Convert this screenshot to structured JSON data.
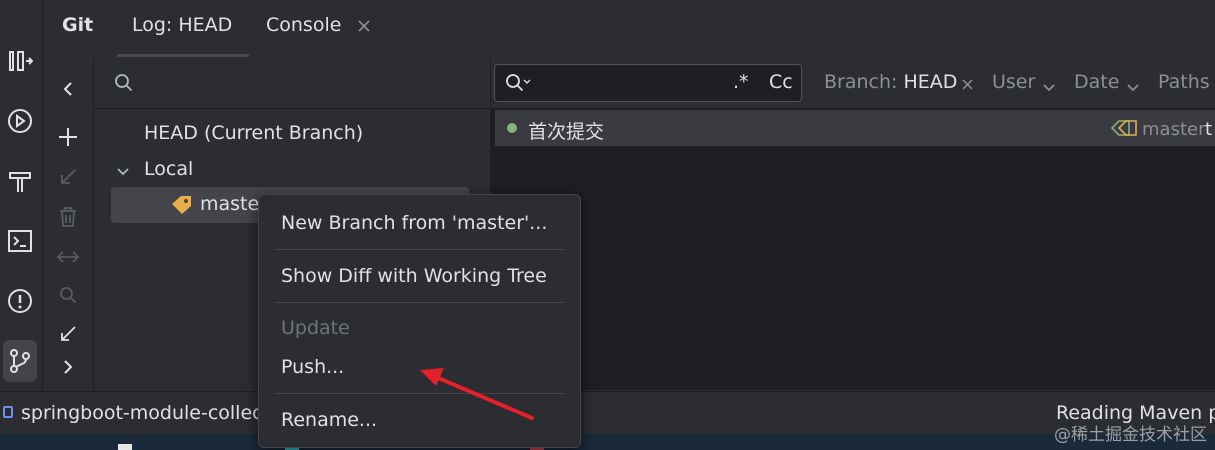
{
  "tabs": {
    "git": "Git",
    "log": "Log: HEAD",
    "console": "Console"
  },
  "branches": {
    "head_label": "HEAD (Current Branch)",
    "local_label": "Local",
    "selected_branch": "master"
  },
  "log": {
    "search_regex": ".*",
    "search_case": "Cc",
    "filters": {
      "branch_key": "Branch: ",
      "branch_value": "HEAD",
      "user": "User",
      "date": "Date",
      "paths": "Paths"
    },
    "commit": {
      "message": "首次提交",
      "ref": "master",
      "trailing": "t"
    }
  },
  "context_menu": {
    "items": [
      {
        "label": "New Branch from 'master'...",
        "enabled": true
      },
      {
        "label": "Show Diff with Working Tree",
        "enabled": true
      },
      {
        "label": "Update",
        "enabled": false
      },
      {
        "label": "Push...",
        "enabled": true
      },
      {
        "label": "Rename...",
        "enabled": true
      }
    ]
  },
  "statusbar": {
    "project": "springboot-module-collec",
    "task": "Reading Maven p"
  },
  "watermark": "@稀土掘金技术社区",
  "colors": {
    "bg": "#2b2d30",
    "log_bg": "#1e1f22",
    "selection": "#43454a",
    "tag": "#e8b04b",
    "commit_dot": "#8ab37a",
    "arrow": "#e5202a"
  },
  "icons": [
    "pull-requests-icon",
    "run-icon",
    "build-icon",
    "terminal-icon",
    "problems-icon",
    "git-icon",
    "chevron-left-icon",
    "plus-icon",
    "checkout-icon",
    "delete-icon",
    "compare-icon",
    "search-icon",
    "collapse-icon",
    "chevron-right-icon",
    "tag-icon",
    "close-icon",
    "chevron-down-icon"
  ]
}
